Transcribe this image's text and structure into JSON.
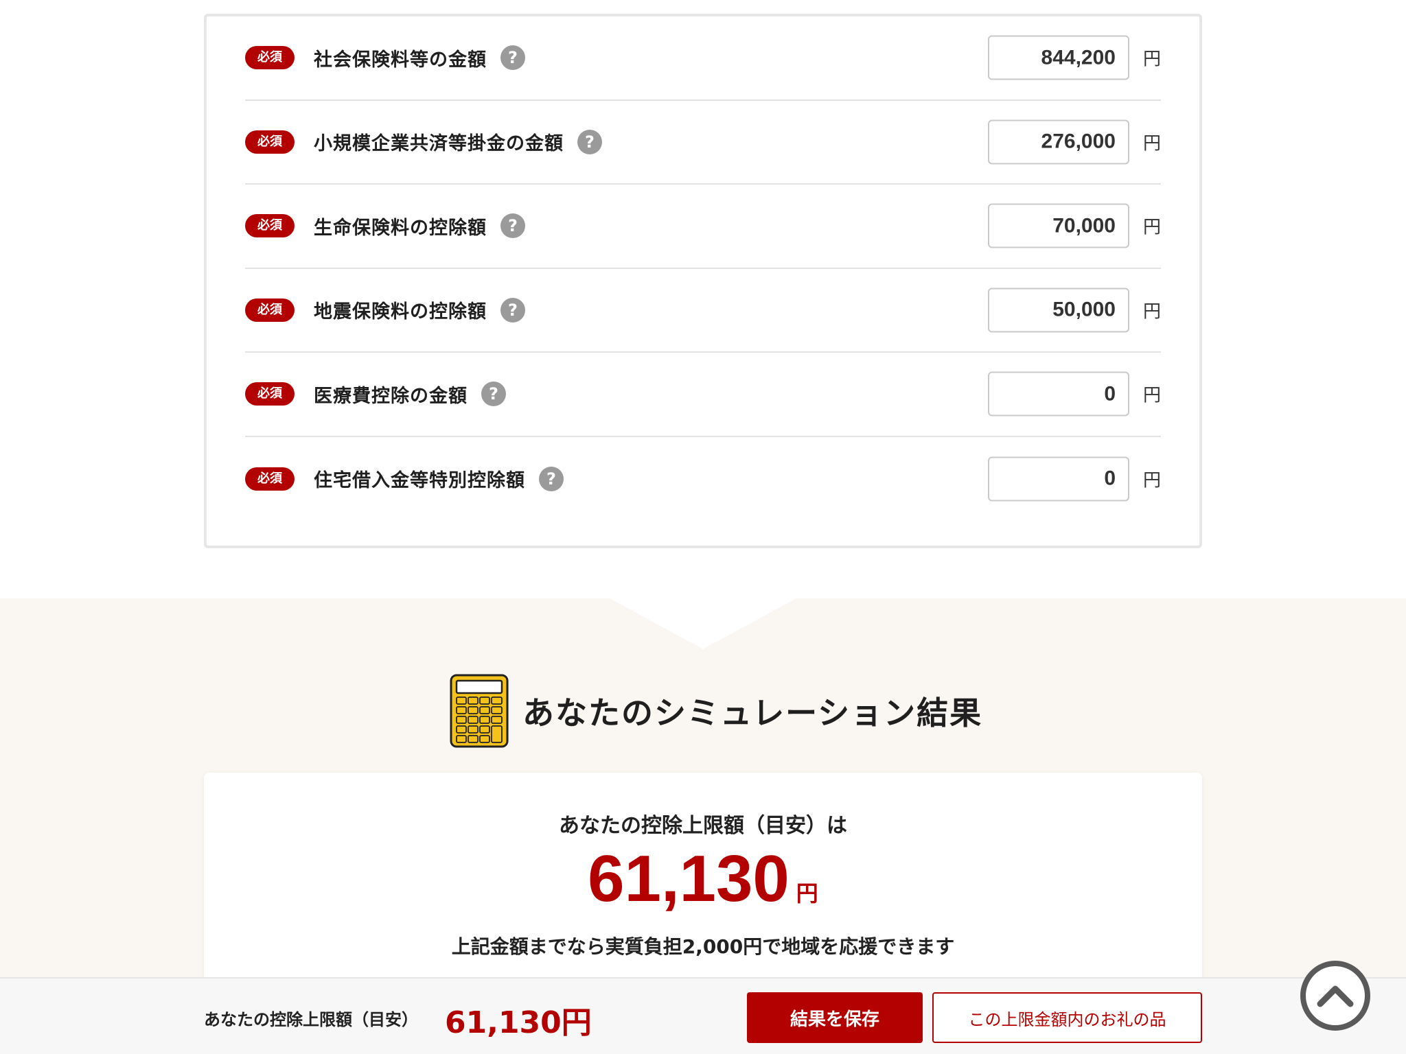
{
  "form": {
    "required_label": "必須",
    "help_glyph": "?",
    "unit": "円",
    "rows": [
      {
        "label": "社会保険料等の金額",
        "value": "844,200"
      },
      {
        "label": "小規模企業共済等掛金の金額",
        "value": "276,000"
      },
      {
        "label": "生命保険料の控除額",
        "value": "70,000"
      },
      {
        "label": "地震保険料の控除額",
        "value": "50,000"
      },
      {
        "label": "医療費控除の金額",
        "value": "0"
      },
      {
        "label": "住宅借入金等特別控除額",
        "value": "0"
      }
    ]
  },
  "result": {
    "icon": "calculator-icon",
    "title": "あなたのシミュレーション結果",
    "lead": "あなたの控除上限額（目安）は",
    "amount": "61,130",
    "amount_unit": "円",
    "note": "上記金額までなら実質負担2,000円で地域を応援できます"
  },
  "footer": {
    "label": "あなたの控除上限額（目安）",
    "amount": "61,130円",
    "save_label": "結果を保存",
    "gifts_label": "この上限金額内のお礼の品"
  },
  "back_to_top": {
    "icon": "chevron-up-icon"
  },
  "colors": {
    "accent": "#b30000",
    "section_bg": "#faf6f1",
    "calculator_yellow": "#f5c21b"
  }
}
